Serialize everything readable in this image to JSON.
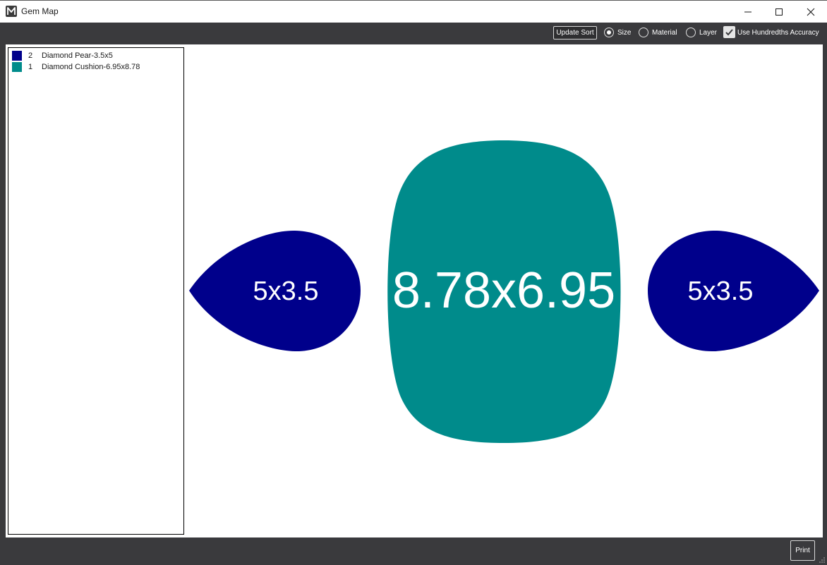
{
  "window": {
    "title": "Gem Map",
    "icon": "app-logo-icon",
    "controls": [
      "minimize-icon",
      "maximize-icon",
      "close-icon"
    ]
  },
  "toolbar": {
    "update_sort_label": "Update Sort",
    "sort_options": [
      {
        "label": "Size",
        "selected": true
      },
      {
        "label": "Material",
        "selected": false
      },
      {
        "label": "Layer",
        "selected": false
      }
    ],
    "hundredths": {
      "label": "Use Hundredths Accuracy",
      "checked": true
    }
  },
  "legend": {
    "items": [
      {
        "count": "2",
        "name": "Diamond Pear-3.5x5",
        "color": "#00008b"
      },
      {
        "count": "1",
        "name": "Diamond Cushion-6.95x8.78",
        "color": "#008b8b"
      }
    ]
  },
  "gems": [
    {
      "shape": "pear",
      "label": "5x3.5",
      "color": "#00008b",
      "point": "left"
    },
    {
      "shape": "cushion",
      "label": "8.78x6.95",
      "color": "#008b8b"
    },
    {
      "shape": "pear",
      "label": "5x3.5",
      "color": "#00008b",
      "point": "right"
    }
  ],
  "footer": {
    "print_label": "Print"
  }
}
